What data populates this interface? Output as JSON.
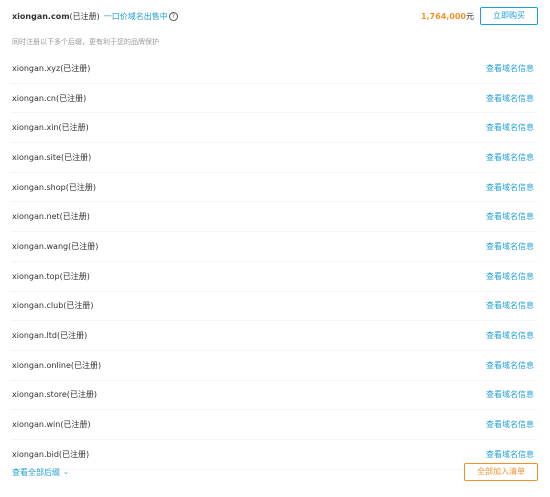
{
  "header": {
    "domain": "xiongan.com",
    "status": "(已注册)",
    "sale_link": "一口价域名出售中",
    "info_icon": "?",
    "price": "1,764,000",
    "price_unit": "元",
    "buy_label": "立即购买"
  },
  "hint": "同时注册以下多个后缀，更有利于您的品牌保护",
  "rows": [
    {
      "domain": "xiongan.xyz",
      "status": "(已注册)",
      "link": "查看域名信息"
    },
    {
      "domain": "xiongan.cn",
      "status": "(已注册)",
      "link": "查看域名信息"
    },
    {
      "domain": "xiongan.xin",
      "status": "(已注册)",
      "link": "查看域名信息"
    },
    {
      "domain": "xiongan.site",
      "status": "(已注册)",
      "link": "查看域名信息"
    },
    {
      "domain": "xiongan.shop",
      "status": "(已注册)",
      "link": "查看域名信息"
    },
    {
      "domain": "xiongan.net",
      "status": "(已注册)",
      "link": "查看域名信息"
    },
    {
      "domain": "xiongan.wang",
      "status": "(已注册)",
      "link": "查看域名信息"
    },
    {
      "domain": "xiongan.top",
      "status": "(已注册)",
      "link": "查看域名信息"
    },
    {
      "domain": "xiongan.club",
      "status": "(已注册)",
      "link": "查看域名信息"
    },
    {
      "domain": "xiongan.ltd",
      "status": "(已注册)",
      "link": "查看域名信息"
    },
    {
      "domain": "xiongan.online",
      "status": "(已注册)",
      "link": "查看域名信息"
    },
    {
      "domain": "xiongan.store",
      "status": "(已注册)",
      "link": "查看域名信息"
    },
    {
      "domain": "xiongan.win",
      "status": "(已注册)",
      "link": "查看域名信息"
    },
    {
      "domain": "xiongan.bid",
      "status": "(已注册)",
      "link": "查看域名信息"
    }
  ],
  "footer": {
    "view_all": "查看全部后缀",
    "add_all": "全部加入清单"
  },
  "colors": {
    "link": "#1e9fd4",
    "price": "#f0932b"
  }
}
